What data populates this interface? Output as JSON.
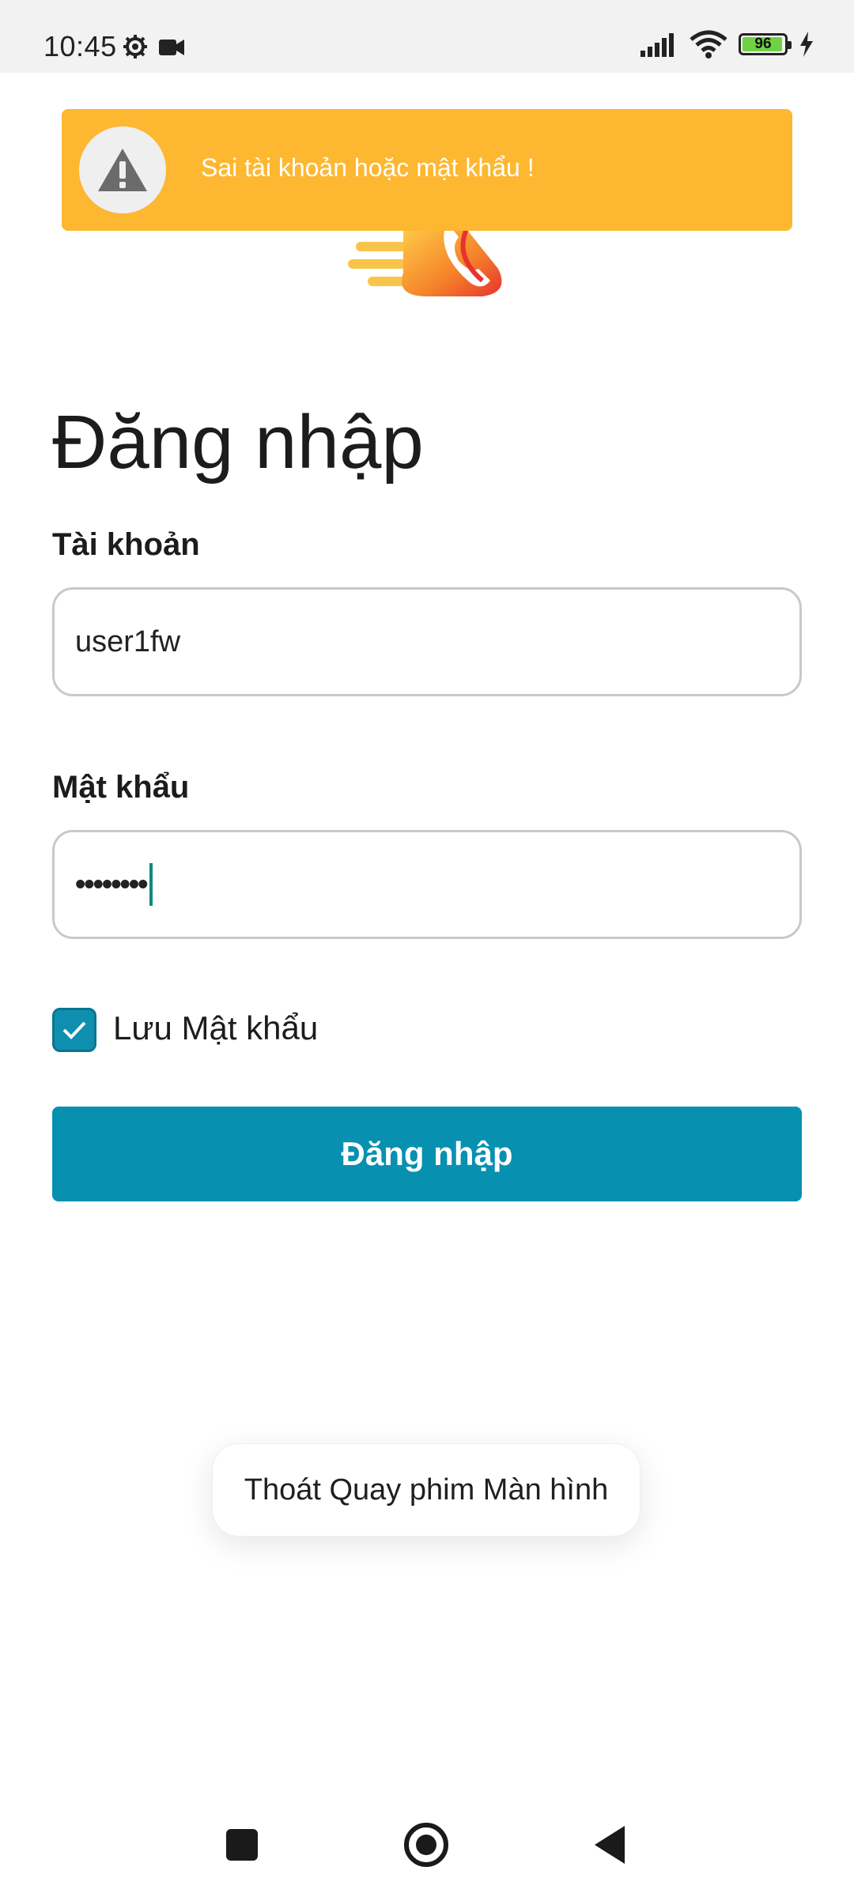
{
  "status_bar": {
    "time": "10:45",
    "left_icons": [
      "gear-icon",
      "video-camera-icon"
    ],
    "right_icons": [
      "signal-icon",
      "wifi-icon",
      "battery-icon",
      "charging-bolt-icon"
    ],
    "battery_level": "96",
    "battery_fraction": 0.96,
    "battery_color": "#6fd244"
  },
  "alert": {
    "message": "Sai tài khoản hoặc mật khẩu !",
    "icon": "warning-icon",
    "color": "#fdb731"
  },
  "logo": {
    "icon": "app-logo-phone-icon"
  },
  "form": {
    "title": "Đăng nhập",
    "username_label": "Tài khoản",
    "username_value": "user1fw",
    "password_label": "Mật khẩu",
    "password_value": "••••••••",
    "remember_label": "Lưu Mật khẩu",
    "remember_checked": true,
    "submit_label": "Đăng nhập",
    "accent_color": "#0890b1"
  },
  "toast": {
    "message": "Thoát Quay phim Màn hình"
  },
  "nav_bar": {
    "items": [
      "recents-square-icon",
      "home-circle-icon",
      "back-triangle-icon"
    ]
  }
}
